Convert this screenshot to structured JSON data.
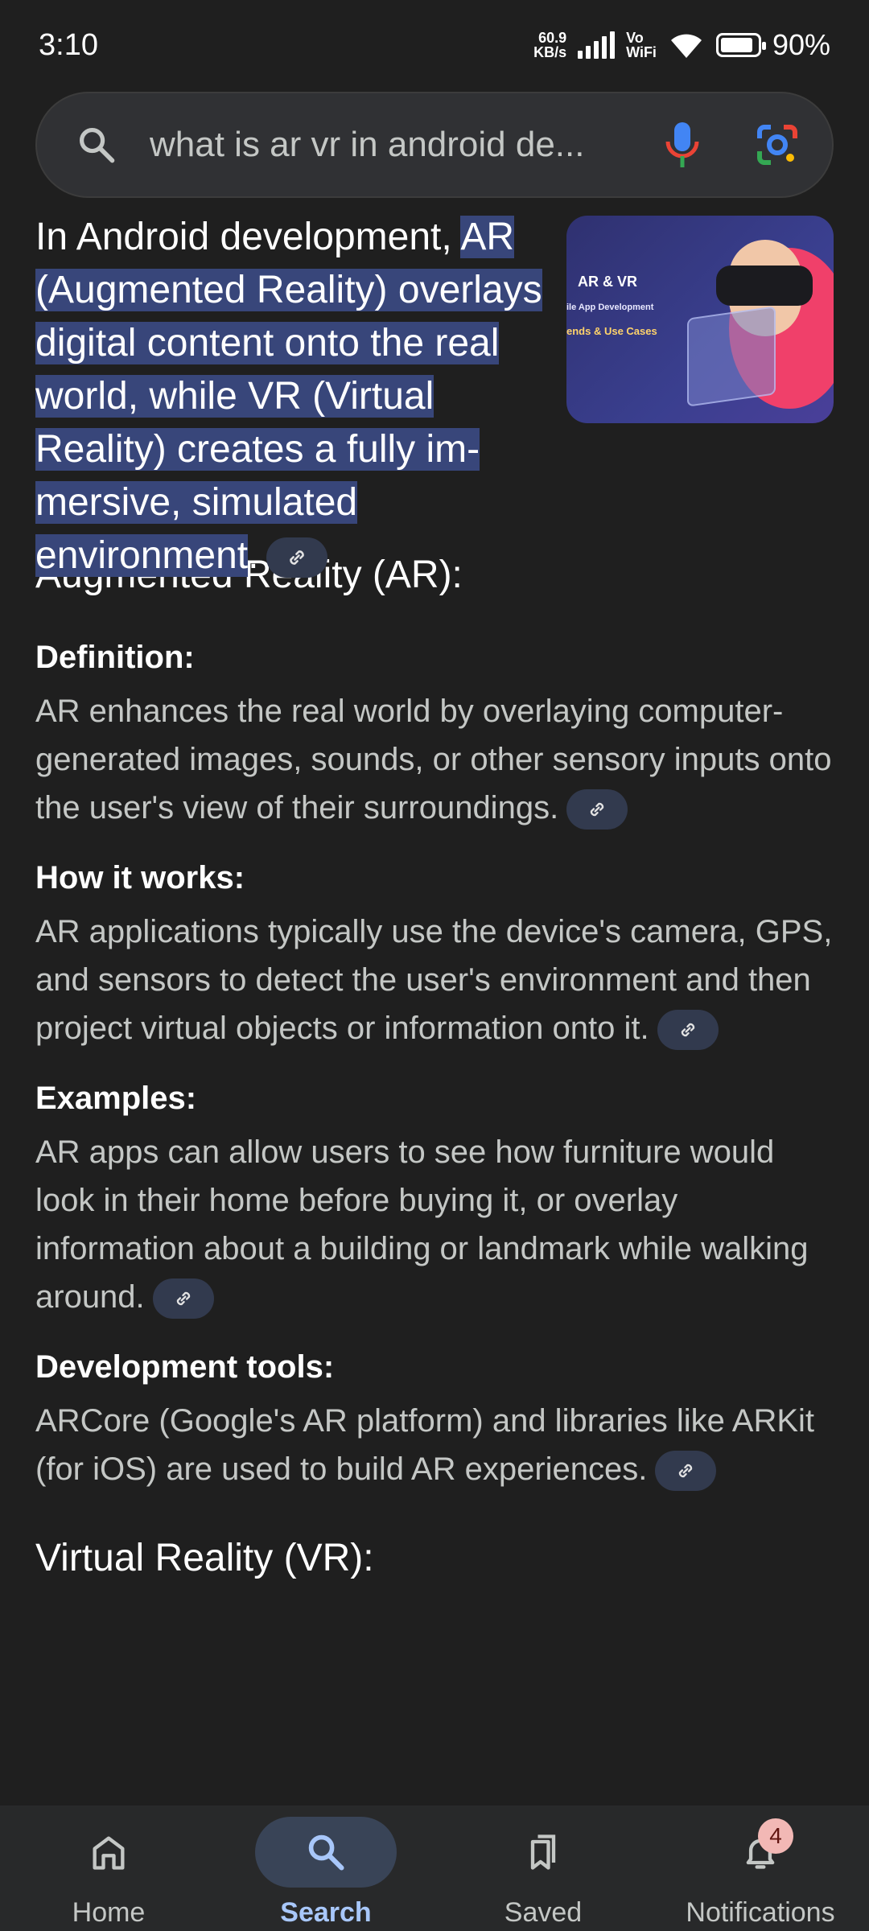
{
  "status_bar": {
    "time": "3:10",
    "net_speed_value": "60.9",
    "net_speed_unit": "KB/s",
    "vowifi_top": "Vo",
    "vowifi_bottom": "WiFi",
    "battery": "90%"
  },
  "search": {
    "query": "what is ar vr in android de..."
  },
  "result": {
    "intro_plain": "In Android development, ",
    "intro_highlight": "AR (Augmented Reality) over­lays digital content onto the real world, while VR (Virtual Reality) creates a fully im­mersive, simulated environment",
    "intro_end": ".",
    "image_title": "AR & VR",
    "image_sub": "ile App Development",
    "image_sub2": "ends & Use Cases",
    "section_ar": "Augmented Reality (AR):",
    "items": [
      {
        "heading": "Definition:",
        "text": "AR enhances the real world by overlaying computer-generated images, sounds, or other sensory inputs onto the user's view of their surroundings."
      },
      {
        "heading": "How it works:",
        "text": "AR applications typically use the device's camera, GPS, and sensors to detect the user's environment and then project virtual objects or information onto it."
      },
      {
        "heading": "Examples:",
        "text": "AR apps can allow users to see how furniture would look in their home before buying it, or overlay information about a building or landmark while walking around."
      },
      {
        "heading": "Development tools:",
        "text": "ARCore (Google's AR platform) and libraries like ARKit (for iOS) are used to build AR experiences."
      }
    ],
    "section_vr": "Virtual Reality (VR):"
  },
  "bottom_nav": {
    "items": [
      {
        "label": "Home",
        "icon": "home-icon"
      },
      {
        "label": "Search",
        "icon": "search-icon",
        "active": true
      },
      {
        "label": "Saved",
        "icon": "bookmarks-icon"
      },
      {
        "label": "Notifications",
        "icon": "bell-icon",
        "badge": "4"
      }
    ]
  },
  "colors": {
    "background": "#1f1f1f",
    "highlight": "#38467a",
    "accent": "#a8c7fa"
  }
}
